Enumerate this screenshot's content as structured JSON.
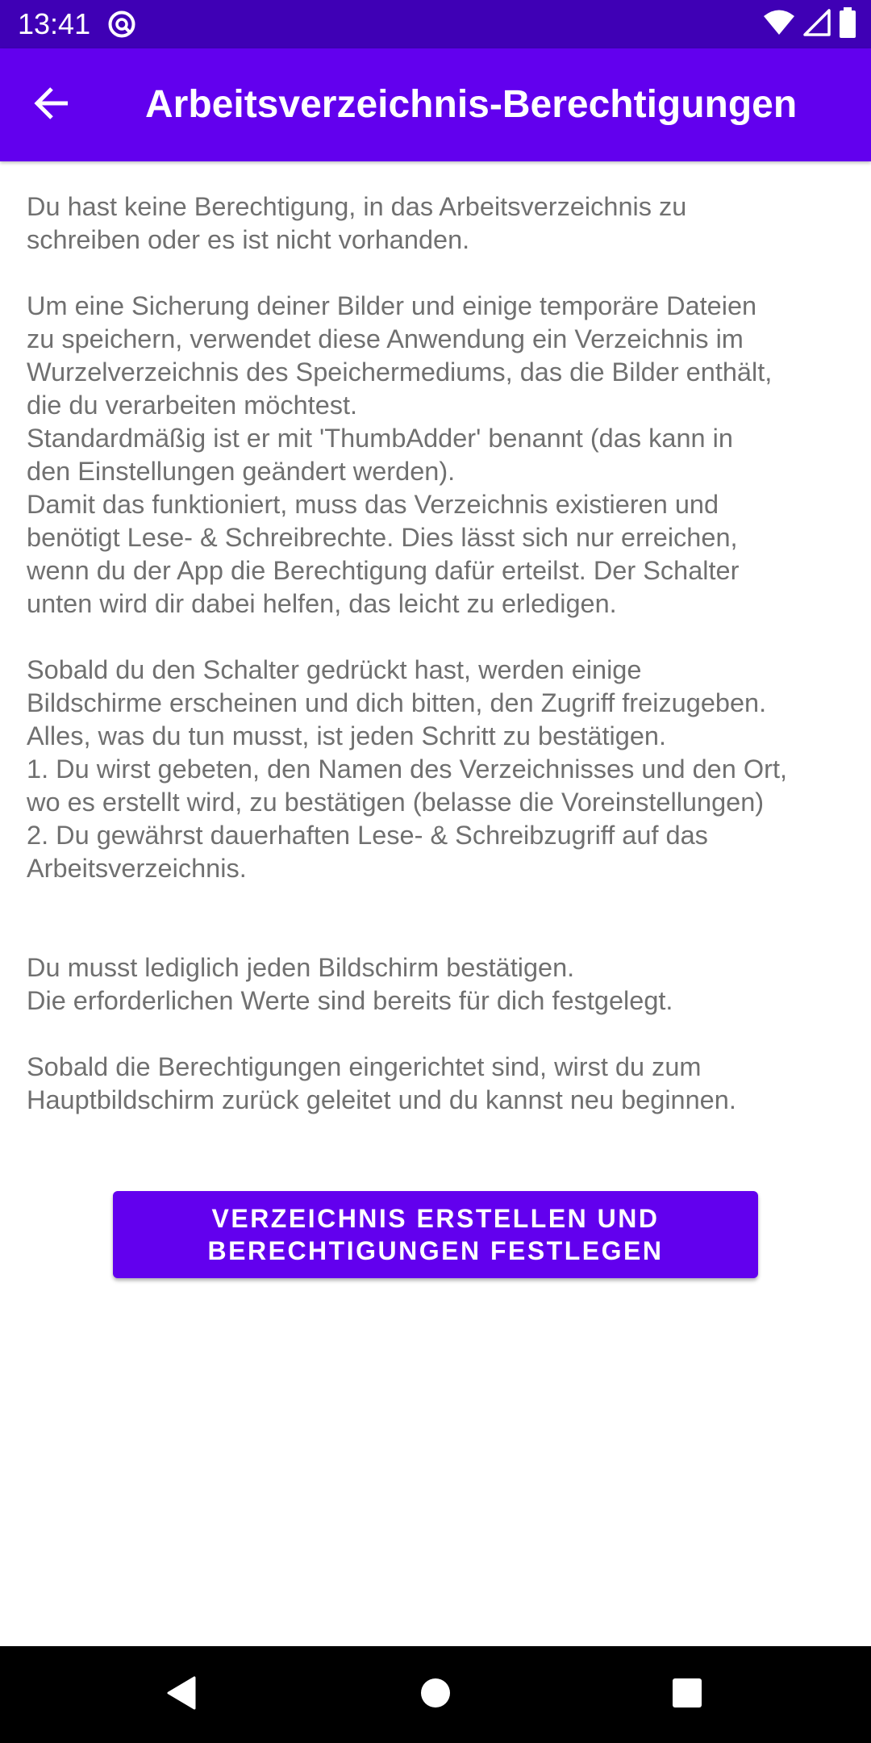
{
  "status_bar": {
    "time": "13:41",
    "icons": [
      "app-notification-icon",
      "wifi-icon",
      "cell-signal-icon",
      "battery-icon"
    ]
  },
  "app_bar": {
    "back_icon": "arrow-left-icon",
    "title": "Arbeitsverzeichnis-Berechtigungen",
    "color": "#6200ee"
  },
  "main": {
    "description": "Du hast keine Berechtigung, in das Arbeitsverzeichnis zu\nschreiben oder es ist nicht vorhanden.\n\n Um eine Sicherung deiner Bilder und einige temporäre Dateien\nzu speichern, verwendet diese Anwendung ein Verzeichnis im\nWurzelverzeichnis des Speichermediums, das die Bilder enthält,\ndie du verarbeiten möchtest.\n Standardmäßig ist er mit 'ThumbAdder' benannt (das kann in\nden Einstellungen geändert werden).\n Damit das funktioniert, muss das Verzeichnis existieren und\nbenötigt Lese- & Schreibrechte. Dies lässt sich nur erreichen,\nwenn du der App die Berechtigung dafür erteilst. Der Schalter\nunten wird dir dabei helfen, das leicht zu erledigen.\n\n Sobald du den Schalter gedrückt hast, werden einige\nBildschirme erscheinen und dich bitten, den Zugriff freizugeben.\nAlles, was du tun musst, ist jeden Schritt zu bestätigen.\n 1. Du wirst gebeten, den Namen des Verzeichnisses und den Ort,\nwo es erstellt wird, zu bestätigen (belasse die Voreinstellungen)\n 2. Du gewährst dauerhaften Lese- & Schreibzugriff auf das\nArbeitsverzeichnis.\n\n\n Du musst lediglich jeden Bildschirm bestätigen.\n Die erforderlichen Werte sind bereits für dich festgelegt.\n\n Sobald die Berechtigungen eingerichtet sind, wirst du zum\nHauptbildschirm zurück geleitet und du kannst neu beginnen.",
    "button_label": "VERZEICHNIS ERSTELLEN UND\nBERECHTIGUNGEN FESTLEGEN"
  },
  "nav_bar": {
    "icons": [
      "back-triangle-icon",
      "home-circle-icon",
      "recents-square-icon"
    ]
  }
}
